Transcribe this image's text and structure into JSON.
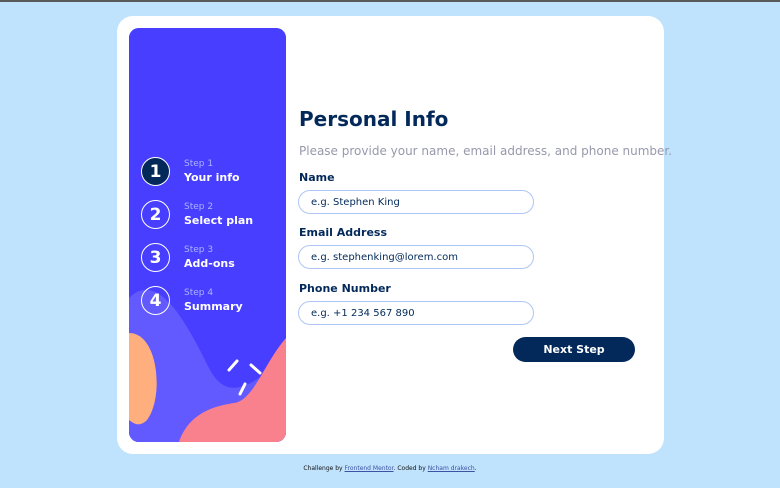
{
  "sidebar": {
    "steps": [
      {
        "number": "1",
        "step_label": "Step 1",
        "title": "Your info",
        "active": true
      },
      {
        "number": "2",
        "step_label": "Step 2",
        "title": "Select plan",
        "active": false
      },
      {
        "number": "3",
        "step_label": "Step 3",
        "title": "Add-ons",
        "active": false
      },
      {
        "number": "4",
        "step_label": "Step 4",
        "title": "Summary",
        "active": false
      }
    ]
  },
  "form": {
    "title": "Personal Info",
    "subtitle": "Please provide your name, email address, and phone number.",
    "fields": [
      {
        "label": "Name",
        "placeholder": "e.g. Stephen King",
        "value": ""
      },
      {
        "label": "Email Address",
        "placeholder": "e.g. stephenking@lorem.com",
        "value": ""
      },
      {
        "label": "Phone Number",
        "placeholder": "e.g. +1 234 567 890",
        "value": ""
      }
    ],
    "next_label": "Next Step"
  },
  "footer": {
    "prefix": "Challenge by ",
    "link1": "Frontend Mentor",
    "middle": ". Coded by ",
    "link2": "Ncham drakech",
    "suffix": "."
  },
  "colors": {
    "page_bg": "#bfe2fd",
    "sidebar_bg": "#483eff",
    "primary": "#02295a",
    "input_border": "#aec6f5",
    "blob_orange": "#ffaf7e",
    "blob_pink": "#f9818e"
  }
}
